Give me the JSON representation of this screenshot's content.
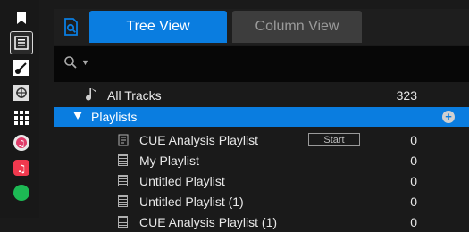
{
  "sidebar": {
    "items": [
      {
        "name": "bookmark-icon",
        "active": false
      },
      {
        "name": "list-view-icon",
        "active": true
      },
      {
        "name": "guitar-icon",
        "active": false
      },
      {
        "name": "explorer-icon",
        "active": false
      },
      {
        "name": "grid-icon",
        "active": false
      },
      {
        "name": "itunes-icon",
        "active": false
      },
      {
        "name": "music-app-icon",
        "active": false
      },
      {
        "name": "green-app-icon",
        "active": false
      }
    ]
  },
  "tabs": {
    "tree_label": "Tree View",
    "column_label": "Column View"
  },
  "search": {
    "value": ""
  },
  "tree": {
    "all_tracks": {
      "label": "All Tracks",
      "count": "323"
    },
    "playlists": {
      "label": "Playlists"
    },
    "items": [
      {
        "label": "CUE Analysis Playlist",
        "count": "0",
        "button": "Start"
      },
      {
        "label": "My Playlist",
        "count": "0"
      },
      {
        "label": "Untitled Playlist",
        "count": "0"
      },
      {
        "label": "Untitled Playlist (1)",
        "count": "0"
      },
      {
        "label": "CUE Analysis Playlist (1)",
        "count": "0"
      }
    ]
  },
  "colors": {
    "accent": "#0a7de0",
    "background": "#1a1a1a",
    "search_bg": "#070707"
  }
}
